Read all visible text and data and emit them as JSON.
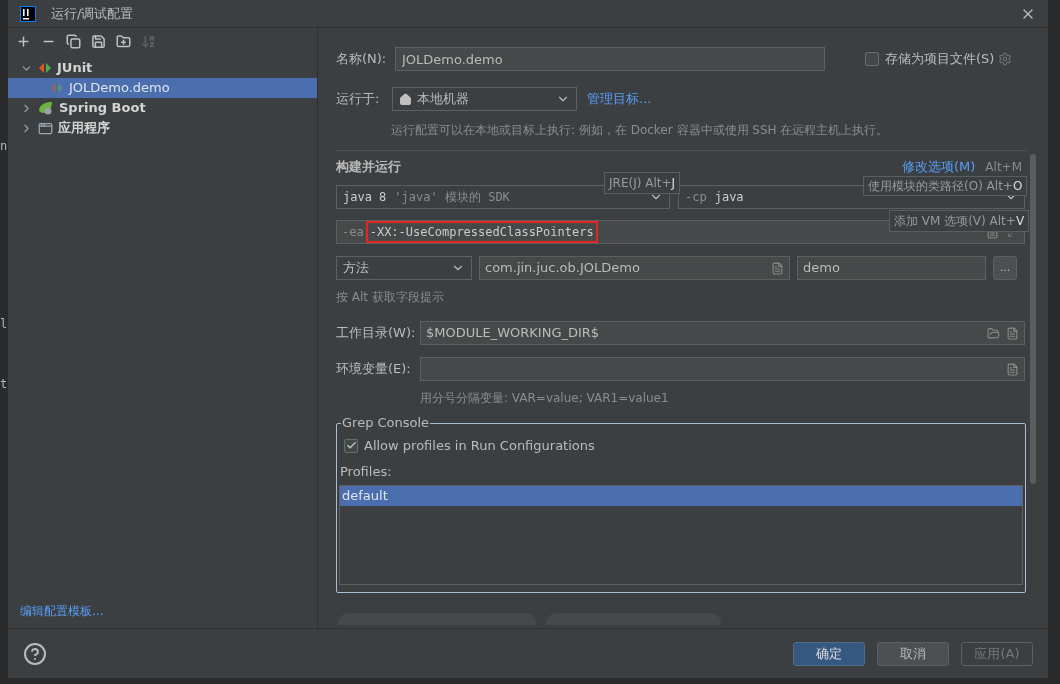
{
  "background_editor": {
    "fragments": [
      "n",
      "l",
      "t"
    ]
  },
  "window": {
    "title": "运行/调试配置"
  },
  "toolbar": {
    "buttons": [
      {
        "kind": "add",
        "disabled": false
      },
      {
        "kind": "remove",
        "disabled": false
      },
      {
        "kind": "copy",
        "disabled": false
      },
      {
        "kind": "save",
        "disabled": false
      },
      {
        "kind": "folder",
        "disabled": false
      },
      {
        "kind": "sort",
        "disabled": true
      }
    ]
  },
  "tree": [
    {
      "label": "JUnit",
      "kind": "junit",
      "expanded": true,
      "selected": false,
      "children": [
        {
          "label": "JOLDemo.demo",
          "kind": "junit-config",
          "selected": true
        }
      ]
    },
    {
      "label": "Spring Boot",
      "kind": "spring",
      "expanded": false,
      "selected": false
    },
    {
      "label": "应用程序",
      "kind": "application",
      "expanded": false,
      "selected": false
    }
  ],
  "edit_templates_link": "编辑配置模板...",
  "name": {
    "label": "名称(N):",
    "value": "JOLDemo.demo"
  },
  "store_as_project_file": {
    "label": "存储为项目文件(S)",
    "checked": false
  },
  "run_on": {
    "label": "运行于:",
    "value": "本地机器",
    "link": "管理目标...",
    "hint": "运行配置可以在本地或目标上执行: 例如，在 Docker 容器中或使用 SSH 在远程主机上执行。"
  },
  "build_and_run": {
    "title": "构建并运行",
    "modify_options": "修改选项(M)",
    "modify_shortcut": "Alt+M",
    "sdk": {
      "value": "java 8",
      "secondary": "'java' 模块的 SDK"
    },
    "classpath": {
      "prefix": "-cp",
      "value": "java"
    },
    "vm_options": {
      "prefix": "-ea",
      "value": "-XX:-UseCompressedClassPointers",
      "highlighted": true
    },
    "test_kind": "方法",
    "class": "com.jin.juc.ob.JOLDemo",
    "method": "demo",
    "more_button": "...",
    "hint": "按 Alt 获取字段提示"
  },
  "tooltips": [
    {
      "label": "JRE(J) Alt+",
      "key": "J"
    },
    {
      "label": "使用模块的类路径(O) Alt+",
      "key": "O"
    },
    {
      "label": "添加 VM 选项(V) Alt+",
      "key": "V"
    }
  ],
  "working_dir": {
    "label": "工作目录(W):",
    "value": "$MODULE_WORKING_DIR$"
  },
  "env_vars": {
    "label": "环境变量(E):",
    "hint": "用分号分隔变量: VAR=value; VAR1=value1"
  },
  "grep_console": {
    "title": "Grep Console",
    "allow_profiles": {
      "label": "Allow profiles in Run Configurations",
      "checked": true
    },
    "profiles_label": "Profiles:",
    "profiles": [
      {
        "label": "default",
        "selected": true
      }
    ]
  },
  "footer": {
    "buttons": [
      {
        "label": "确定",
        "kind": "primary",
        "disabled": false
      },
      {
        "label": "取消",
        "kind": "normal",
        "disabled": false
      },
      {
        "label": "应用(A)",
        "kind": "normal",
        "disabled": true
      }
    ]
  }
}
